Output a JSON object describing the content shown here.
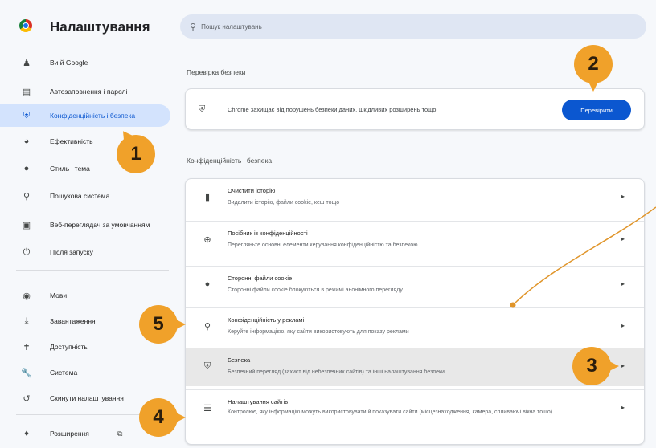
{
  "app": {
    "title": "Налаштування"
  },
  "search": {
    "placeholder": "Пошук налаштувань"
  },
  "sidebar": {
    "items": [
      {
        "label": "Ви й Google",
        "icon": "person-icon"
      },
      {
        "label": "Автозаповнення і паролі",
        "icon": "clipboard-icon"
      },
      {
        "label": "Конфіденційність і безпека",
        "icon": "shield-icon",
        "active": true
      },
      {
        "label": "Ефективність",
        "icon": "speedometer-icon"
      },
      {
        "label": "Стиль і тема",
        "icon": "palette-icon"
      },
      {
        "label": "Пошукова система",
        "icon": "search-icon"
      },
      {
        "label": "Веб-переглядач за умовчанням",
        "icon": "browser-icon"
      },
      {
        "label": "Після запуску",
        "icon": "power-icon"
      },
      {
        "label": "Мови",
        "icon": "globe-icon"
      },
      {
        "label": "Завантаження",
        "icon": "download-icon"
      },
      {
        "label": "Доступність",
        "icon": "accessibility-icon"
      },
      {
        "label": "Система",
        "icon": "wrench-icon"
      },
      {
        "label": "Скинути налаштування",
        "icon": "reset-icon"
      },
      {
        "label": "Розширення",
        "icon": "puzzle-icon"
      }
    ]
  },
  "safety": {
    "heading": "Перевірка безпеки",
    "text": "Chrome захищає від порушень безпеки даних, шкідливих розширень тощо",
    "button": "Перевірити"
  },
  "privacy": {
    "heading": "Конфіденційність і безпека",
    "rows": [
      {
        "title": "Очистити історію",
        "subtitle": "Видалити історію, файли cookie, кеш тощо",
        "icon": "trash-icon"
      },
      {
        "title": "Посібник із конфіденційності",
        "subtitle": "Перегляньте основні елементи керування конфіденційністю та безпекою",
        "icon": "add-circle-icon"
      },
      {
        "title": "Сторонні файли cookie",
        "subtitle": "Сторонні файли cookie блокуються в режимі анонімного перегляду",
        "icon": "cookie-icon"
      },
      {
        "title": "Конфіденційність у рекламі",
        "subtitle": "Керуйте інформацією, яку сайти використовують для показу реклами",
        "icon": "ad-privacy-icon"
      },
      {
        "title": "Безпека",
        "subtitle": "Безпечний перегляд (захист від небезпечних сайтів) та інші налаштування безпеки",
        "icon": "security-icon"
      },
      {
        "title": "Налаштування сайтів",
        "subtitle": "Контролює, яку інформацію можуть використовувати й показувати сайти (місцезнаходження, камера, спливаючі вікна тощо)",
        "icon": "sliders-icon"
      }
    ]
  },
  "callouts": [
    "1",
    "2",
    "3",
    "4",
    "5"
  ],
  "colors": {
    "accent": "#0b57d0",
    "active_bg": "#d3e3fd",
    "callout": "#f0a12a",
    "leader": "#e0952a"
  }
}
